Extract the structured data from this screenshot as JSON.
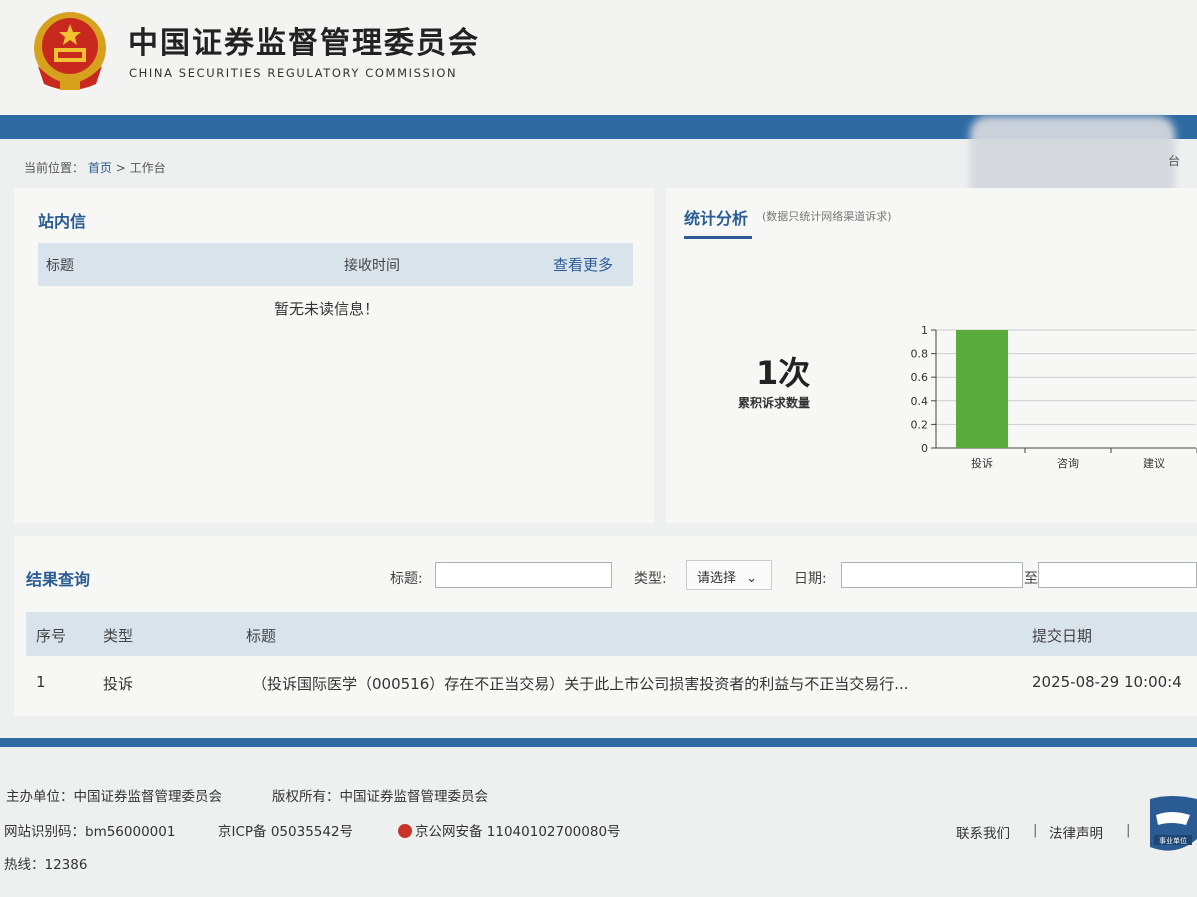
{
  "header": {
    "org_name_cn": "中国证券监督管理委员会",
    "org_name_en": "CHINA SECURITIES REGULATORY COMMISSION",
    "top_right_text": "台"
  },
  "breadcrumb": {
    "prefix": "当前位置：",
    "home": "首页",
    "separator": ">",
    "current": "工作台"
  },
  "messages": {
    "title": "站内信",
    "col_title": "标题",
    "col_time": "接收时间",
    "more_link": "查看更多",
    "empty_text": "暂无未读信息！"
  },
  "stats": {
    "tab_label": "统计分析",
    "tab_note": "(数据只统计网络渠道诉求)",
    "total_value": "1次",
    "total_label": "累积诉求数量"
  },
  "chart_data": {
    "type": "bar",
    "categories": [
      "投诉",
      "咨询",
      "建议"
    ],
    "values": [
      1,
      0,
      0
    ],
    "ylim": [
      0,
      1
    ],
    "yticks": [
      "0",
      "0.2",
      "0.4",
      "0.6",
      "0.8",
      "1"
    ],
    "grid": true,
    "bar_color": "#5aab3b"
  },
  "search": {
    "title": "结果查询",
    "title_label": "标题:",
    "title_value": "",
    "type_label": "类型:",
    "type_selected": "请选择",
    "date_label": "日期:",
    "date_from": "",
    "date_to_label": "至",
    "date_to": ""
  },
  "table": {
    "headers": [
      "序号",
      "类型",
      "标题",
      "提交日期"
    ],
    "rows": [
      {
        "index": "1",
        "type": "投诉",
        "title": "（投诉国际医学（000516）存在不正当交易）关于此上市公司损害投资者的利益与不正当交易行...",
        "date": "2025-08-29 10:00:4"
      }
    ]
  },
  "footer": {
    "sponsor": "主办单位：中国证券监督管理委员会",
    "copyright": "版权所有：中国证券监督管理委员会",
    "site_id": "网站识别码：bm56000001",
    "icp": "京ICP备 05035542号",
    "police": "京公网安备 11040102700080号",
    "hotline": "热线：12386",
    "contact": "联系我们",
    "legal": "法律声明",
    "divider": "|",
    "badge_text": "事业单位"
  },
  "colors": {
    "brand_blue": "#2f6aa3",
    "title_blue": "#2a5c93",
    "bar_green": "#5aab3b"
  }
}
